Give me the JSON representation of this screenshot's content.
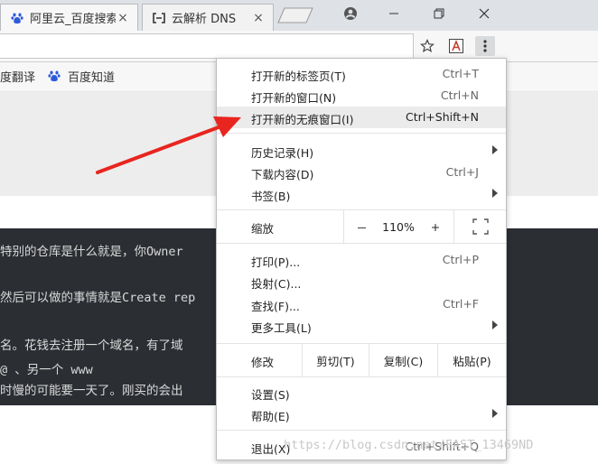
{
  "tabs": [
    {
      "title": "阿里云_百度搜索",
      "close": "×",
      "favicon": "baidu-paw"
    },
    {
      "title": "云解析 DNS",
      "close": "×",
      "favicon": "aliyun-logo"
    }
  ],
  "bookmarks": [
    {
      "label": "度翻译"
    },
    {
      "label": "百度知道",
      "icon": "baidu-paw"
    }
  ],
  "code_lines": [
    "特别的仓库是什么就是，你Owner",
    "然后可以做的事情就是Create rep",
    "名。花钱去注册一个域名，有了域",
    "@ 、另一个 www",
    "时慢的可能要一天了。刚买的会出"
  ],
  "menu": {
    "group1": [
      {
        "label": "打开新的标签页(T)",
        "shortcut": "Ctrl+T"
      },
      {
        "label": "打开新的窗口(N)",
        "shortcut": "Ctrl+N"
      },
      {
        "label": "打开新的无痕窗口(I)",
        "shortcut": "Ctrl+Shift+N"
      }
    ],
    "group2": [
      {
        "label": "历史记录(H)",
        "shortcut": ""
      },
      {
        "label": "下载内容(D)",
        "shortcut": "Ctrl+J"
      },
      {
        "label": "书签(B)",
        "shortcut": ""
      }
    ],
    "zoom": {
      "label": "缩放",
      "minus": "－",
      "value": "110%",
      "plus": "+"
    },
    "group3": [
      {
        "label": "打印(P)...",
        "shortcut": "Ctrl+P"
      },
      {
        "label": "投射(C)...",
        "shortcut": ""
      },
      {
        "label": "查找(F)...",
        "shortcut": "Ctrl+F"
      },
      {
        "label": "更多工具(L)",
        "shortcut": ""
      }
    ],
    "edit": {
      "label": "修改",
      "cut": "剪切(T)",
      "copy": "复制(C)",
      "paste": "粘贴(P)"
    },
    "group4": [
      {
        "label": "设置(S)",
        "shortcut": ""
      },
      {
        "label": "帮助(E)",
        "shortcut": ""
      }
    ],
    "exit": {
      "label": "退出(X)",
      "shortcut": "Ctrl+Shift+Q"
    }
  },
  "watermark": "https://blog.csdn.net/FAST_13469ND",
  "colors": {
    "annotation_arrow": "#e8251f",
    "menu_highlight": "#ebebeb",
    "code_bg": "#2b2e33"
  }
}
